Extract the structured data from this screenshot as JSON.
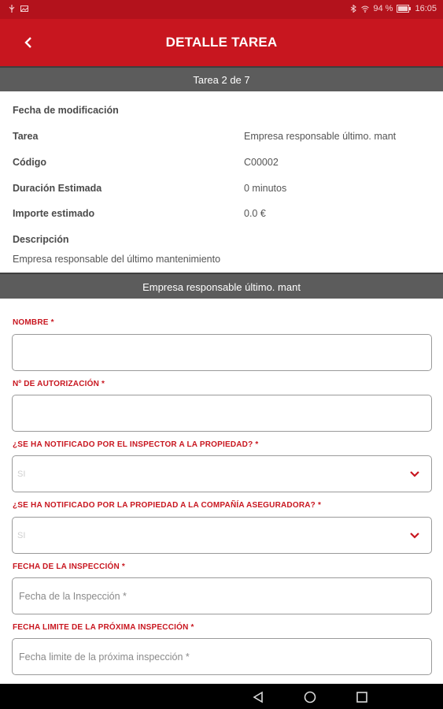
{
  "status_bar": {
    "battery": "94 %",
    "time": "16:05"
  },
  "header": {
    "title": "DETALLE TAREA"
  },
  "task_counter": "Tarea 2 de 7",
  "details": {
    "rows": [
      {
        "label": "Fecha de modificación",
        "value": ""
      },
      {
        "label": "Tarea",
        "value": "Empresa responsable último. mant"
      },
      {
        "label": "Código",
        "value": "C00002"
      },
      {
        "label": "Duración Estimada",
        "value": "0 minutos"
      },
      {
        "label": "Importe estimado",
        "value": "0.0 €"
      }
    ],
    "description_label": "Descripción",
    "description_text": "Empresa responsable del último mantenimiento"
  },
  "section_title": "Empresa responsable último. mant",
  "form": {
    "nombre": {
      "label": "NOMBRE *",
      "value": ""
    },
    "autorizacion": {
      "label": "Nº DE AUTORIZACIÓN *",
      "value": ""
    },
    "notif_inspector": {
      "label": "¿SE HA NOTIFICADO POR EL INSPECTOR A LA PROPIEDAD? *",
      "selected": "SI"
    },
    "notif_propiedad": {
      "label": "¿SE HA NOTIFICADO POR LA PROPIEDAD A LA COMPAÑÍA ASEGURADORA? *",
      "selected": "SI"
    },
    "fecha_inspeccion": {
      "label": "FECHA DE LA INSPECCIÓN *",
      "placeholder": "Fecha de la Inspección *"
    },
    "fecha_limite": {
      "label": "FECHA LIMITE DE LA PRÓXIMA INSPECCIÓN *",
      "placeholder": "Fecha limite de la próxima inspección *"
    }
  },
  "colors": {
    "primary": "#c8161f",
    "status_bar": "#b3121c",
    "section_bar": "#5c5c5c"
  },
  "icons": {
    "back": "chevron-left-icon",
    "dropdown": "chevron-down-icon",
    "nav_back": "triangle-back-icon",
    "nav_home": "circle-home-icon",
    "nav_recents": "square-recents-icon"
  }
}
